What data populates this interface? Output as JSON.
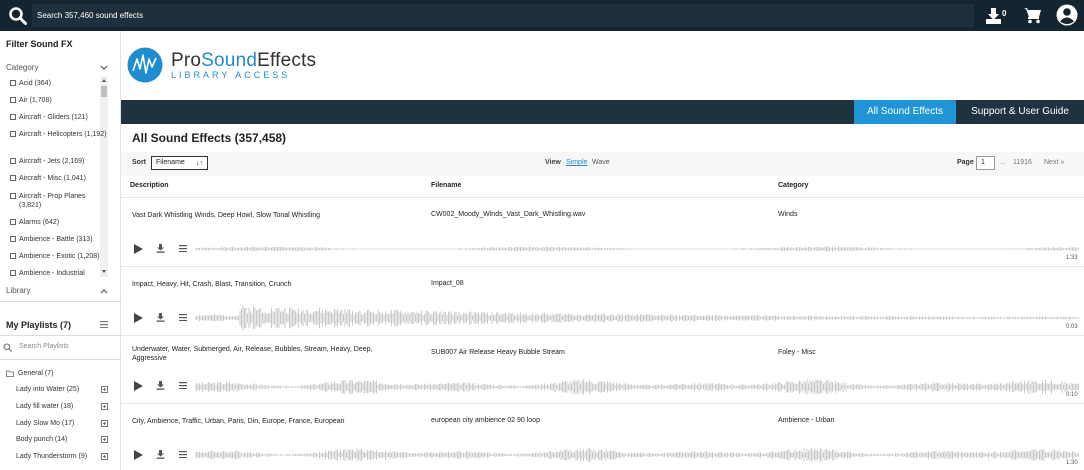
{
  "topbar": {
    "search_placeholder": "Search 357,460 sound effects",
    "download_count": "0"
  },
  "sidebar": {
    "filter_title": "Filter Sound FX",
    "category_label": "Category",
    "categories": [
      "Acid (364)",
      "Air (1,708)",
      "Aircraft - Gliders (121)",
      "Aircraft - Helicopters (1,192)",
      "Aircraft - Jets (2,169)",
      "Aircraft - Misc (1,041)",
      "Aircraft - Prop Planes (3,821)",
      "Alarms (642)",
      "Ambience - Battle (313)",
      "Ambience - Exotic (1,208)",
      "Ambience - Industrial"
    ],
    "library_label": "Library",
    "playlists_title": "My Playlists (7)",
    "playlists_search_placeholder": "Search Playlists",
    "folder_label": "General (7)",
    "playlists": [
      "Lady into Water (25)",
      "Lady fill water (18)",
      "Lady Slow Mo (17)",
      "Body punch (14)",
      "Lady Thunderstorm (9)"
    ]
  },
  "header": {
    "brand_name_1": "Pro",
    "brand_name_2": "Sound",
    "brand_name_3": "Effects",
    "brand_sub": "LIBRARY ACCESS",
    "nav_all": "All Sound Effects",
    "nav_support": "Support & User Guide"
  },
  "main": {
    "title": "All Sound Effects (357,458)",
    "sort_label": "Sort",
    "sort_value": "Filename",
    "view_label": "View",
    "view_simple": "Simple",
    "view_wave": "Wave",
    "page_label": "Page",
    "page_value": "1",
    "page_ellipsis": "...",
    "page_total": "11916",
    "next_label": "Next »",
    "columns": [
      "Description",
      "Filename",
      "Category"
    ],
    "rows": [
      {
        "description": "Vast Dark Whistling Winds, Deep Howl, Slow Tonal Whistling",
        "filename": "CW002_Moody_Winds_Vast_Dark_Whistling.wav",
        "category": "Winds",
        "duration": "1:33"
      },
      {
        "description": "Impact, Heavy, Hit, Crash, Blast, Transition, Crunch",
        "filename": "Impact_08",
        "category": "",
        "duration": "0:03"
      },
      {
        "description": "Underwater, Water, Submerged, Air, Release, Bubbles, Stream, Heavy, Deep, Aggressive",
        "filename": "SUB007 Air Release Heavy Bubble Stream",
        "category": "Foley - Misc",
        "duration": "0:10"
      },
      {
        "description": "City, Ambience, Traffic, Urban, Paris, Din, Europe, France, European",
        "filename": "european city ambience 02 90 loop",
        "category": "Ambience - Urban",
        "duration": "1:30"
      }
    ]
  },
  "colors": {
    "topbar": "#142431",
    "navbar": "#1f323f",
    "accent": "#1f95d8",
    "wave": "#c8c8c8"
  },
  "icons": [
    "search-icon",
    "download-icon",
    "cart-icon",
    "user-icon",
    "play-icon",
    "menu-icon",
    "folder-icon",
    "add-icon",
    "chevron-icon"
  ]
}
